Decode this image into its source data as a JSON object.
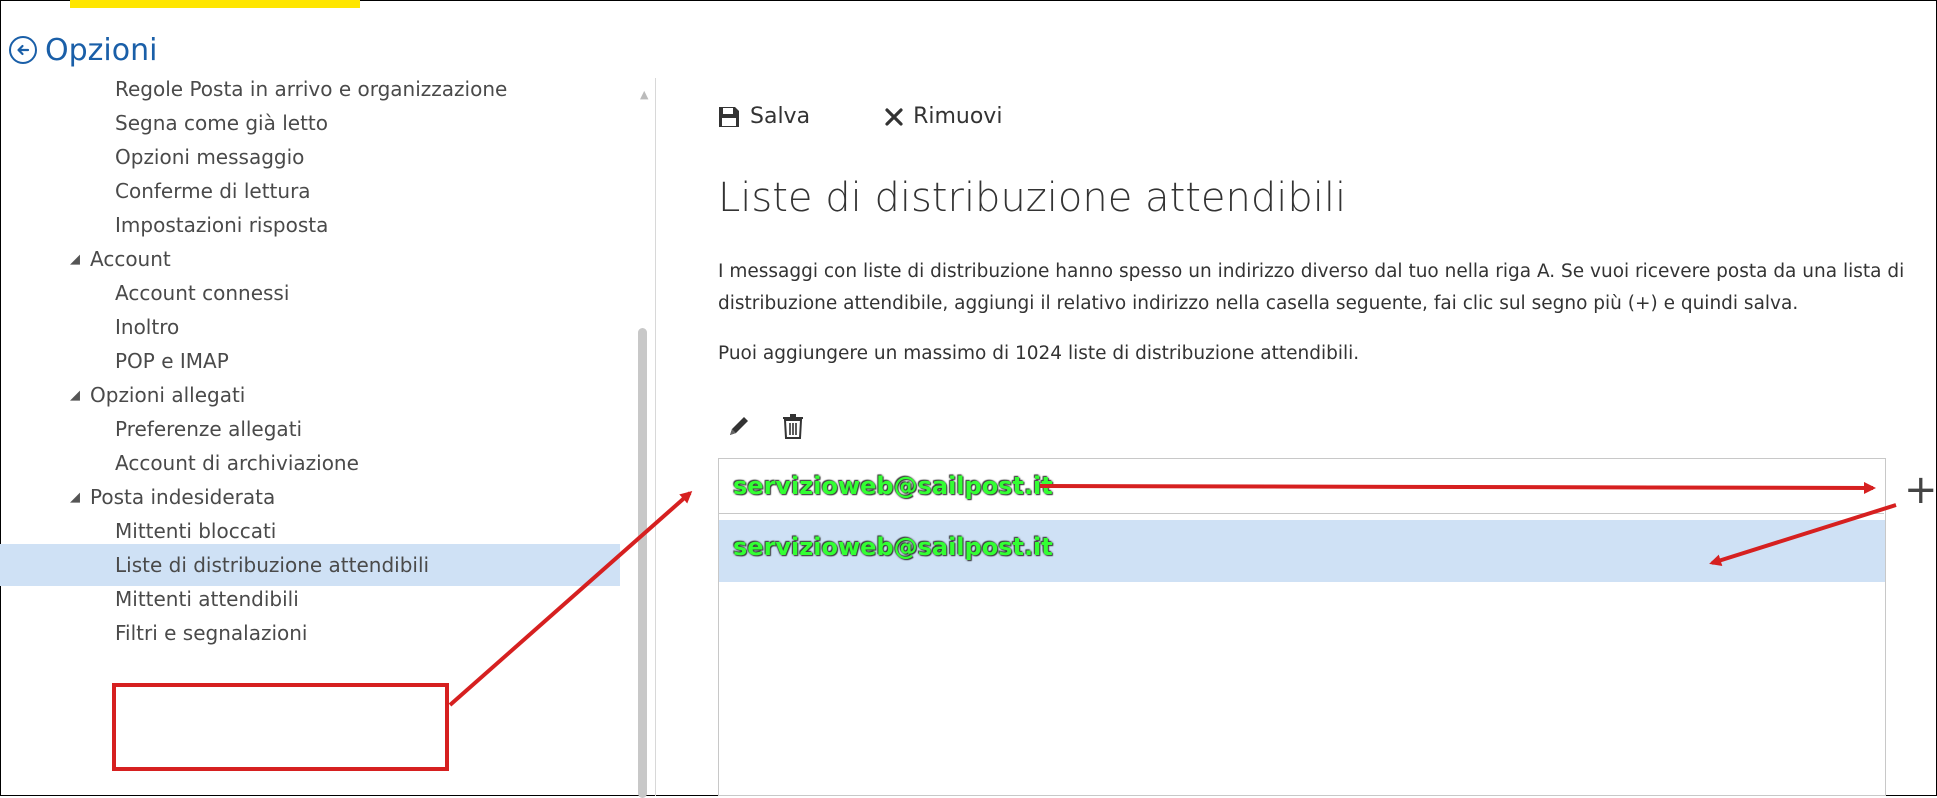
{
  "header": {
    "title": "Opzioni",
    "back_icon": "arrow-circle-left-icon",
    "accent": "#1a5fa8"
  },
  "sidebar": {
    "items": [
      {
        "label": "Regole Posta in arrivo e organizzazione",
        "level": "sub"
      },
      {
        "label": "Segna come già letto",
        "level": "sub"
      },
      {
        "label": "Opzioni messaggio",
        "level": "sub"
      },
      {
        "label": "Conferme di lettura",
        "level": "sub"
      },
      {
        "label": "Impostazioni risposta",
        "level": "sub"
      },
      {
        "label": "Account",
        "level": "group"
      },
      {
        "label": "Account connessi",
        "level": "sub"
      },
      {
        "label": "Inoltro",
        "level": "sub"
      },
      {
        "label": "POP e IMAP",
        "level": "sub"
      },
      {
        "label": "Opzioni allegati",
        "level": "group"
      },
      {
        "label": "Preferenze allegati",
        "level": "sub"
      },
      {
        "label": "Account di archiviazione",
        "level": "sub"
      },
      {
        "label": "Posta indesiderata",
        "level": "group"
      },
      {
        "label": "Mittenti bloccati",
        "level": "sub"
      },
      {
        "label": "Liste di distribuzione attendibili",
        "level": "sub",
        "selected": true
      },
      {
        "label": "Mittenti attendibili",
        "level": "sub"
      },
      {
        "label": "Filtri e segnalazioni",
        "level": "sub"
      }
    ],
    "selected_color": "#cfe1f5"
  },
  "toolbar": {
    "save_label": "Salva",
    "remove_label": "Rimuovi"
  },
  "main": {
    "title": "Liste di distribuzione attendibili",
    "description": "I messaggi con liste di distribuzione hanno spesso un indirizzo diverso dal tuo nella riga A. Se vuoi ricevere posta da una lista di distribuzione attendibile, aggiungi il relativo indirizzo nella casella seguente, fai clic sul segno più (+) e quindi salva.",
    "limit_note": "Puoi aggiungere un massimo di 1024 liste di distribuzione attendibili.",
    "input_value": "servizioweb@sailpost.it",
    "add_icon": "plus-icon",
    "list_items": [
      "servizioweb@sailpost.it"
    ]
  },
  "annotations": {
    "arrow_color": "#d62020",
    "box_color": "#d62020",
    "highlight_color": "#ffe600",
    "email_color": "#33ff33"
  }
}
